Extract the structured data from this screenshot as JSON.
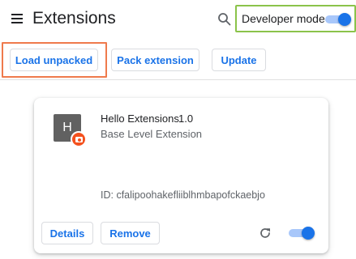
{
  "header": {
    "title": "Extensions",
    "developer_mode": {
      "label": "Developer mode",
      "enabled": true
    }
  },
  "toolbar": {
    "load_unpacked_label": "Load unpacked",
    "pack_extension_label": "Pack extension",
    "update_label": "Update"
  },
  "extension": {
    "icon_letter": "H",
    "name": "Hello Extensions",
    "version": "1.0",
    "description": "Base Level Extension",
    "id_text": "ID: cfalipoohakefliiblhmbapofckaebjo",
    "details_label": "Details",
    "remove_label": "Remove",
    "enabled": true
  },
  "colors": {
    "accent": "#1a73e8",
    "developer_mode_highlight": "#8bc34a",
    "load_unpacked_highlight": "#ef7a4c",
    "badge": "#f4511e"
  },
  "icons": [
    "menu-icon",
    "search-icon",
    "reload-icon",
    "camera-badge-icon"
  ]
}
